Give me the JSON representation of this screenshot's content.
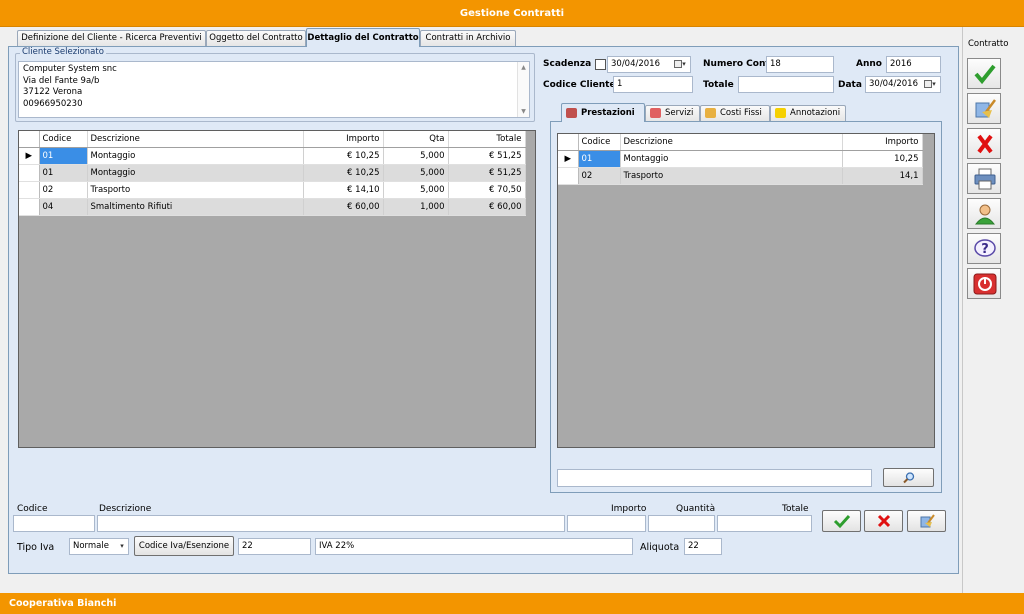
{
  "window": {
    "title": "Gestione Contratti",
    "footer": "Cooperativa Bianchi"
  },
  "tabs": [
    {
      "label": "Definizione del Cliente - Ricerca Preventivi"
    },
    {
      "label": "Oggetto del Contratto"
    },
    {
      "label": "Dettaglio del Contratto"
    },
    {
      "label": "Contratti in Archivio"
    }
  ],
  "cliente": {
    "group_title": "Cliente Selezionato",
    "lines": [
      "Computer System snc",
      "Via del Fante 9a/b",
      "37122 Verona",
      "00966950230"
    ]
  },
  "contract_form": {
    "scadenza_label": "Scadenza",
    "scadenza_value": "30/04/2016",
    "numero_label": "Numero Contr",
    "numero_value": "18",
    "anno_label": "Anno",
    "anno_value": "2016",
    "codice_cliente_label": "Codice Cliente",
    "codice_cliente_value": "1",
    "totale_label": "Totale",
    "totale_value": "",
    "data_label": "Data",
    "data_value": "30/04/2016"
  },
  "detail_grid": {
    "columns": [
      "Codice",
      "Descrizione",
      "Importo",
      "Qta",
      "Totale"
    ],
    "rows": [
      [
        "01",
        "Montaggio",
        "€ 10,25",
        "5,000",
        "€ 51,25"
      ],
      [
        "01",
        "Montaggio",
        "€ 10,25",
        "5,000",
        "€ 51,25"
      ],
      [
        "02",
        "Trasporto",
        "€ 14,10",
        "5,000",
        "€ 70,50"
      ],
      [
        "04",
        "Smaltimento Rifiuti",
        "€ 60,00",
        "1,000",
        "€ 60,00"
      ]
    ]
  },
  "inner_tabs": [
    {
      "label": "Prestazioni",
      "color": "#c0504d"
    },
    {
      "label": "Servizi",
      "color": "#e06060"
    },
    {
      "label": "Costi Fissi",
      "color": "#e8b040"
    },
    {
      "label": "Annotazioni",
      "color": "#f5d000"
    }
  ],
  "prestazioni_grid": {
    "columns": [
      "Codice",
      "Descrizione",
      "Importo"
    ],
    "rows": [
      [
        "01",
        "Montaggio",
        "10,25"
      ],
      [
        "02",
        "Trasporto",
        "14,1"
      ]
    ]
  },
  "entry_form": {
    "codice_label": "Codice",
    "descrizione_label": "Descrizione",
    "importo_label": "Importo",
    "quantita_label": "Quantità",
    "totale_label": "Totale",
    "tipo_iva_label": "Tipo Iva",
    "tipo_iva_value": "Normale",
    "codice_iva_button": "Codice Iva/Esenzione",
    "iva_code_value": "22",
    "iva_desc_value": "IVA 22%",
    "aliquota_label": "Aliquota",
    "aliquota_value": "22"
  },
  "side_toolbar": {
    "title": "Contratto"
  },
  "colors": {
    "accent": "#f39500",
    "panel": "#dfe9f6",
    "selection": "#3a8ee6"
  }
}
